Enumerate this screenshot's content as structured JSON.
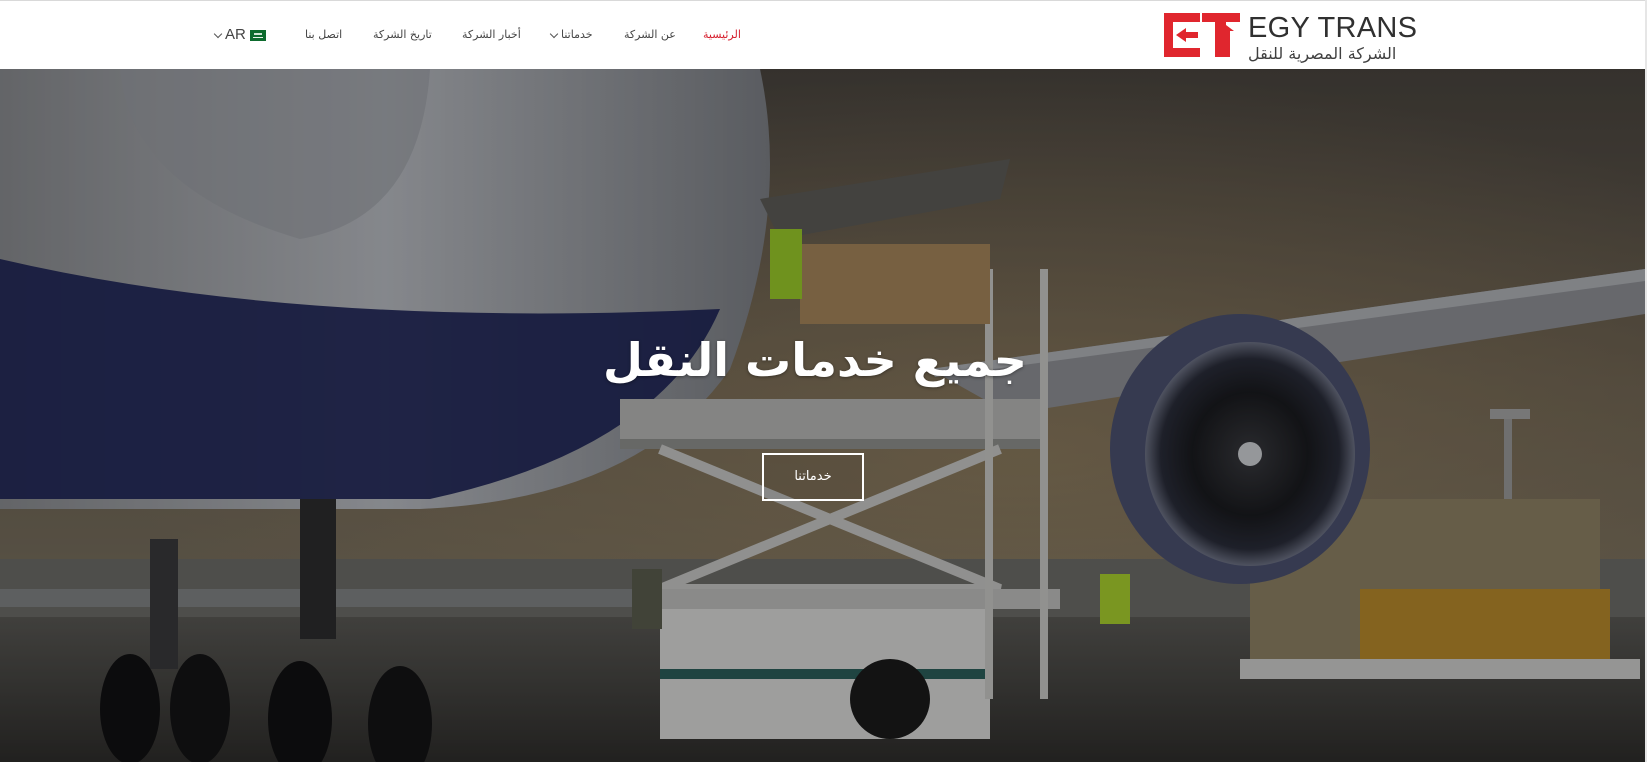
{
  "brand": {
    "logo_mark": "ET",
    "name": "EGY TRANS",
    "subtitle": "الشركة المصرية للنقل",
    "brand_color": "#e0262e"
  },
  "nav": {
    "items": [
      {
        "label": "الرئيسية",
        "active": true
      },
      {
        "label": "عن الشركة",
        "active": false
      },
      {
        "label": "خدماتنا",
        "active": false,
        "has_dropdown": true
      },
      {
        "label": "أخبار الشركة",
        "active": false
      },
      {
        "label": "تاريخ الشركة",
        "active": false
      },
      {
        "label": "اتصل بنا",
        "active": false
      }
    ],
    "language": {
      "code": "AR",
      "flag_icon": "saudi-flag-icon"
    },
    "active_color": "#d61f2e"
  },
  "hero": {
    "title": "جميع خدمات النقل",
    "button_label": "خدماتنا"
  }
}
